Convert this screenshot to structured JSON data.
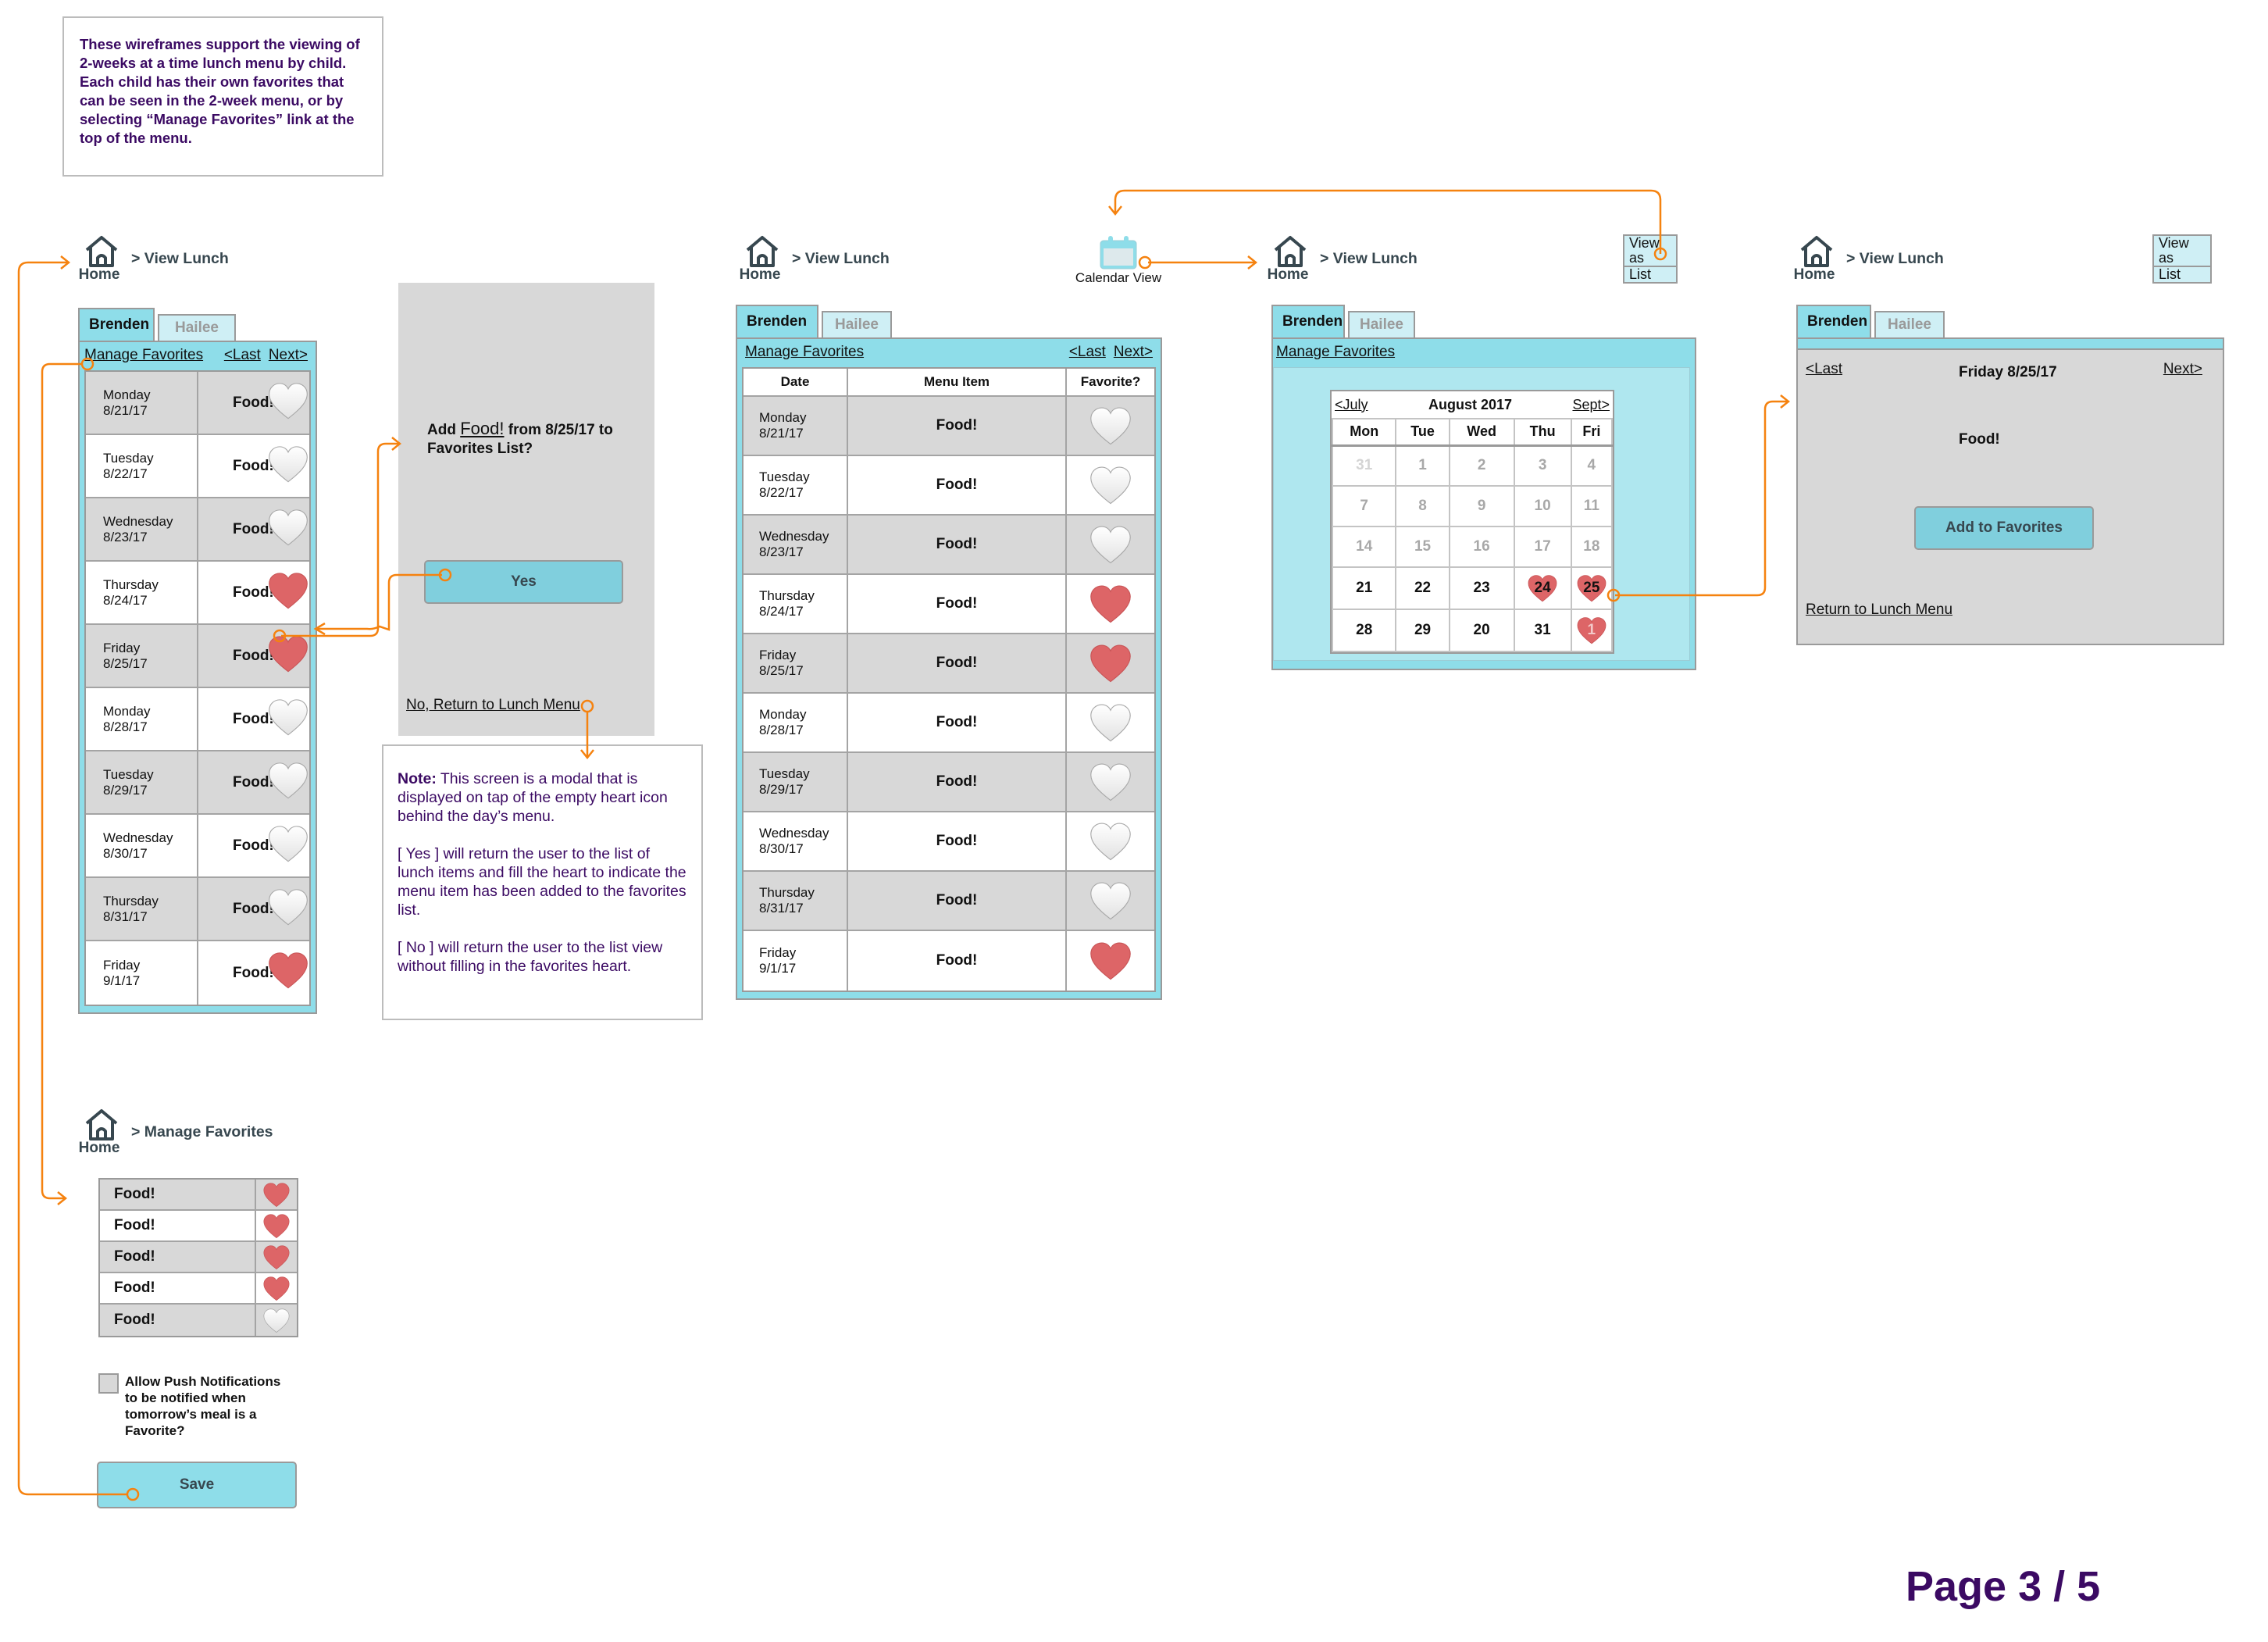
{
  "page": {
    "intro_note": "These wireframes support the viewing of 2-weeks at a time lunch menu by child. Each child has their own favorites that can be seen in the 2-week menu, or by selecting “Manage Favorites” link at the top of the menu.",
    "page_number": "Page 3 / 5"
  },
  "colors": {
    "accent_cyan": "#8edde9",
    "button_cyan": "#80cfdd",
    "heart_red": "#dd6567",
    "connector_orange": "#f5820f",
    "annotation_purple": "#3b0a63"
  },
  "common": {
    "home_label": "Home",
    "view_lunch_crumb": "> View Lunch",
    "tabs": [
      "Brenden",
      "Hailee"
    ],
    "manage_favorites": "Manage Favorites",
    "last": "<Last",
    "next": "Next>",
    "food": "Food!"
  },
  "screen1": {
    "rows": [
      {
        "day": "Monday",
        "date": "8/21/17",
        "food": "Food!",
        "favorite": false
      },
      {
        "day": "Tuesday",
        "date": "8/22/17",
        "food": "Food!",
        "favorite": false
      },
      {
        "day": "Wednesday",
        "date": "8/23/17",
        "food": "Food!",
        "favorite": false
      },
      {
        "day": "Thursday",
        "date": "8/24/17",
        "food": "Food!",
        "favorite": true
      },
      {
        "day": "Friday",
        "date": "8/25/17",
        "food": "Food!",
        "favorite": true
      },
      {
        "day": "Monday",
        "date": "8/28/17",
        "food": "Food!",
        "favorite": false
      },
      {
        "day": "Tuesday",
        "date": "8/29/17",
        "food": "Food!",
        "favorite": false
      },
      {
        "day": "Wednesday",
        "date": "8/30/17",
        "food": "Food!",
        "favorite": false
      },
      {
        "day": "Thursday",
        "date": "8/31/17",
        "food": "Food!",
        "favorite": false
      },
      {
        "day": "Friday",
        "date": "9/1/17",
        "food": "Food!",
        "favorite": true
      }
    ]
  },
  "modal": {
    "prompt_prefix": "Add ",
    "prompt_food": "Food!",
    "prompt_suffix": " from 8/25/17 to Favorites List?",
    "yes_label": "Yes",
    "no_label": "No, Return to Lunch Menu"
  },
  "modal_note": {
    "note_label": "Note:",
    "note_text": " This screen is a modal that is displayed on tap of the empty heart icon behind the day’s menu.",
    "yes_text": "[ Yes ] will return the user to the list of lunch items and fill the heart to indicate the menu item has been added to the favorites list.",
    "no_text": "[ No ] will return the user to the list view without filling in the favorites heart."
  },
  "screen2": {
    "calendar_view_label": "Calendar View",
    "columns": [
      "Date",
      "Menu Item",
      "Favorite?"
    ],
    "rows": [
      {
        "day": "Monday",
        "date": "8/21/17",
        "food": "Food!",
        "favorite": false
      },
      {
        "day": "Tuesday",
        "date": "8/22/17",
        "food": "Food!",
        "favorite": false
      },
      {
        "day": "Wednesday",
        "date": "8/23/17",
        "food": "Food!",
        "favorite": false
      },
      {
        "day": "Thursday",
        "date": "8/24/17",
        "food": "Food!",
        "favorite": true
      },
      {
        "day": "Friday",
        "date": "8/25/17",
        "food": "Food!",
        "favorite": true
      },
      {
        "day": "Monday",
        "date": "8/28/17",
        "food": "Food!",
        "favorite": false
      },
      {
        "day": "Tuesday",
        "date": "8/29/17",
        "food": "Food!",
        "favorite": false
      },
      {
        "day": "Wednesday",
        "date": "8/30/17",
        "food": "Food!",
        "favorite": false
      },
      {
        "day": "Thursday",
        "date": "8/31/17",
        "food": "Food!",
        "favorite": false
      },
      {
        "day": "Friday",
        "date": "9/1/17",
        "food": "Food!",
        "favorite": true
      }
    ]
  },
  "screen3": {
    "view_toggle": [
      "View as",
      "List"
    ],
    "calendar": {
      "prev": "<July",
      "title": "August 2017",
      "next": "Sept>",
      "weekdays": [
        "Mon",
        "Tue",
        "Wed",
        "Thu",
        "Fri"
      ],
      "weeks": [
        [
          {
            "d": "31",
            "s": "outside"
          },
          {
            "d": "1",
            "s": "past"
          },
          {
            "d": "2",
            "s": "past"
          },
          {
            "d": "3",
            "s": "past"
          },
          {
            "d": "4",
            "s": "past"
          }
        ],
        [
          {
            "d": "7",
            "s": "past"
          },
          {
            "d": "8",
            "s": "past"
          },
          {
            "d": "9",
            "s": "past"
          },
          {
            "d": "10",
            "s": "past"
          },
          {
            "d": "11",
            "s": "past"
          }
        ],
        [
          {
            "d": "14",
            "s": "past"
          },
          {
            "d": "15",
            "s": "past"
          },
          {
            "d": "16",
            "s": "past"
          },
          {
            "d": "17",
            "s": "past"
          },
          {
            "d": "18",
            "s": "past"
          }
        ],
        [
          {
            "d": "21",
            "s": "current"
          },
          {
            "d": "22",
            "s": "current"
          },
          {
            "d": "23",
            "s": "current"
          },
          {
            "d": "24",
            "s": "current",
            "fav": true
          },
          {
            "d": "25",
            "s": "current",
            "fav": true
          }
        ],
        [
          {
            "d": "28",
            "s": "current"
          },
          {
            "d": "29",
            "s": "current"
          },
          {
            "d": "20",
            "s": "current"
          },
          {
            "d": "31",
            "s": "current"
          },
          {
            "d": "1",
            "s": "current",
            "fav": true
          }
        ]
      ]
    }
  },
  "screen4": {
    "view_toggle": [
      "View as",
      "List"
    ],
    "day_title": "Friday 8/25/17",
    "food": "Food!",
    "add_button": "Add to Favorites",
    "return_link": "Return to Lunch Menu"
  },
  "manage": {
    "crumb": "> Manage Favorites",
    "items": [
      {
        "food": "Food!",
        "favorite": true
      },
      {
        "food": "Food!",
        "favorite": true
      },
      {
        "food": "Food!",
        "favorite": true
      },
      {
        "food": "Food!",
        "favorite": true
      },
      {
        "food": "Food!",
        "favorite": false
      }
    ],
    "push_label": "Allow Push Notifications to be notified when tomorrow’s meal is a Favorite?",
    "push_checked": false,
    "save_label": "Save"
  }
}
